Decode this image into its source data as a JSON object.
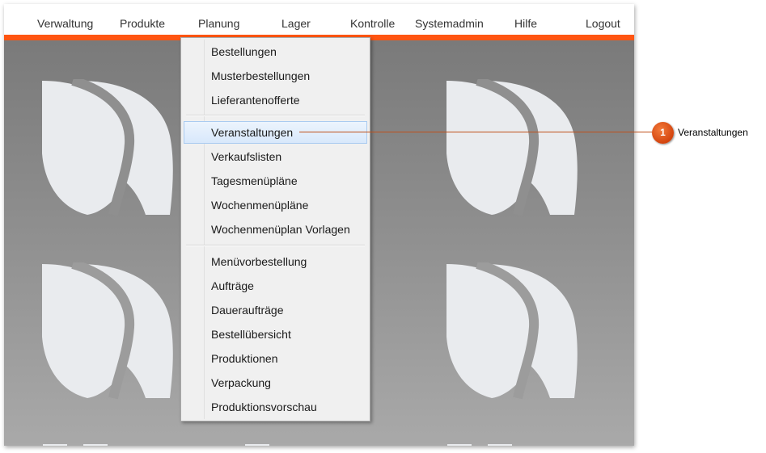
{
  "nav": {
    "items": [
      {
        "label": "Verwaltung"
      },
      {
        "label": "Produkte"
      },
      {
        "label": "Planung"
      },
      {
        "label": "Lager"
      },
      {
        "label": "Kontrolle"
      },
      {
        "label": "Systemadmin"
      },
      {
        "label": "Hilfe"
      },
      {
        "label": "Logout"
      }
    ]
  },
  "menu": {
    "groups": [
      {
        "items": [
          "Bestellungen",
          "Musterbestellungen",
          "Lieferantenofferte"
        ]
      },
      {
        "items": [
          "Veranstaltungen",
          "Verkaufslisten",
          "Tagesmenüpläne",
          "Wochenmenüpläne",
          "Wochenmenüplan Vorlagen"
        ]
      },
      {
        "items": [
          "Menüvorbestellung",
          "Aufträge",
          "Daueraufträge",
          "Bestellübersicht",
          "Produktionen",
          "Verpackung",
          "Produktionsvorschau"
        ]
      }
    ],
    "highlighted": "Veranstaltungen"
  },
  "callout": {
    "number": "1",
    "label": "Veranstaltungen"
  },
  "colors": {
    "accent": "#ff5512",
    "callout": "#d4450f",
    "highlight": "#d8e8fb"
  },
  "icons": {
    "background_logo": "leaf-logo-icon"
  }
}
